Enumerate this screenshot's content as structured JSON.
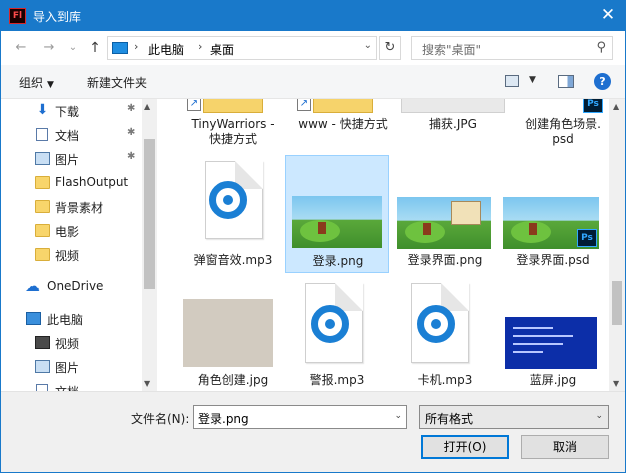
{
  "window": {
    "title": "导入到库",
    "app_icon": "Fl",
    "close_glyph": "✕"
  },
  "nav": {
    "back": "←",
    "forward": "→",
    "recent": "⌄",
    "up": "↑",
    "breadcrumb": [
      "此电脑",
      "桌面"
    ],
    "separator": "›",
    "refresh": "↻",
    "search_placeholder": "搜索\"桌面\"",
    "search_glyph": "⚲"
  },
  "toolbar": {
    "organize": "组织",
    "new_folder": "新建文件夹",
    "help": "?"
  },
  "sidebar": {
    "pin_glyph": "✱",
    "items": [
      {
        "label": "下载",
        "icon": "download-icon",
        "pinned": true
      },
      {
        "label": "文档",
        "icon": "document-icon",
        "pinned": true
      },
      {
        "label": "图片",
        "icon": "picture-icon",
        "pinned": true
      },
      {
        "label": "FlashOutput",
        "icon": "folder-icon"
      },
      {
        "label": "背景素材",
        "icon": "folder-icon"
      },
      {
        "label": "电影",
        "icon": "folder-icon"
      },
      {
        "label": "视频",
        "icon": "folder-icon"
      },
      {
        "label": "OneDrive",
        "icon": "cloud-icon"
      },
      {
        "label": "此电脑",
        "icon": "computer-icon"
      },
      {
        "label": "视频",
        "icon": "video-icon"
      },
      {
        "label": "图片",
        "icon": "picture-icon"
      },
      {
        "label": "文档",
        "icon": "document-icon"
      }
    ]
  },
  "files": [
    {
      "name": "TinyWarriors -\n快捷方式",
      "kind": "folder-shortcut"
    },
    {
      "name": "www - 快捷方式",
      "kind": "folder-shortcut"
    },
    {
      "name": "捕获.JPG",
      "kind": "image"
    },
    {
      "name": "创建角色场景.\npsd",
      "kind": "psd"
    },
    {
      "name": "弹窗音效.mp3",
      "kind": "audio"
    },
    {
      "name": "登录.png",
      "kind": "scene",
      "selected": true
    },
    {
      "name": "登录界面.png",
      "kind": "scene-panel"
    },
    {
      "name": "登录界面.psd",
      "kind": "scene-psd"
    },
    {
      "name": "角色创建.jpg",
      "kind": "sketch"
    },
    {
      "name": "警报.mp3",
      "kind": "audio"
    },
    {
      "name": "卡机.mp3",
      "kind": "audio"
    },
    {
      "name": "蓝屏.jpg",
      "kind": "bsod"
    }
  ],
  "bottom": {
    "filename_label": "文件名(N):",
    "filename_value": "登录.png",
    "format_value": "所有格式",
    "open": "打开(O)",
    "cancel": "取消",
    "dropdown_glyph": "⌄"
  },
  "colors": {
    "accent": "#1979ca",
    "selection": "#cce8ff",
    "media_blue": "#1a7fd4"
  }
}
